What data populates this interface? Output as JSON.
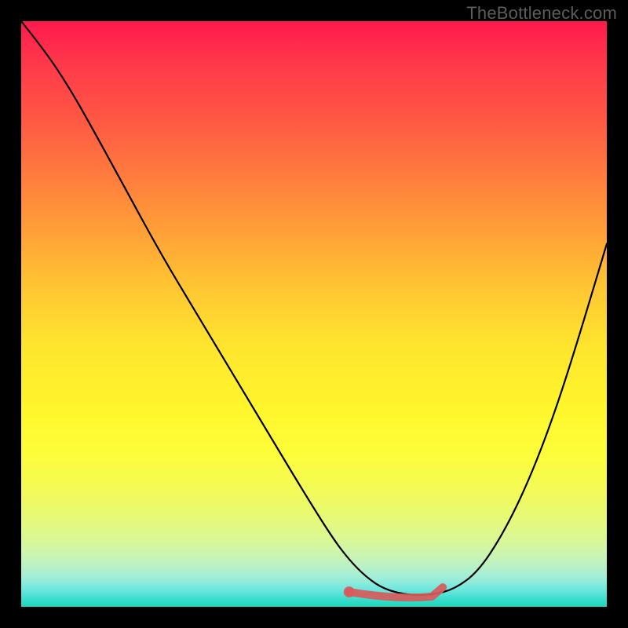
{
  "attribution": "TheBottleneck.com",
  "colors": {
    "background": "#000000",
    "gradient_top": "#ff1a4d",
    "gradient_bottom": "#18d8b8",
    "curve": "#000000",
    "highlight": "#d85a5a"
  },
  "chart_data": {
    "type": "line",
    "title": "",
    "xlabel": "",
    "ylabel": "",
    "xlim": [
      0,
      100
    ],
    "ylim": [
      0,
      100
    ],
    "x": [
      0,
      4,
      8,
      12,
      18,
      24,
      30,
      36,
      42,
      48,
      53,
      56,
      59,
      62,
      66,
      70,
      74,
      78,
      82,
      86,
      90,
      94,
      100
    ],
    "values": [
      100,
      95,
      89,
      82,
      71,
      60,
      50,
      40,
      30,
      20,
      12,
      8,
      5,
      3,
      2,
      2,
      3,
      6,
      12,
      20,
      30,
      42,
      62
    ],
    "highlight_range_x": [
      56,
      72
    ],
    "highlight_y": 2,
    "annotations": []
  }
}
